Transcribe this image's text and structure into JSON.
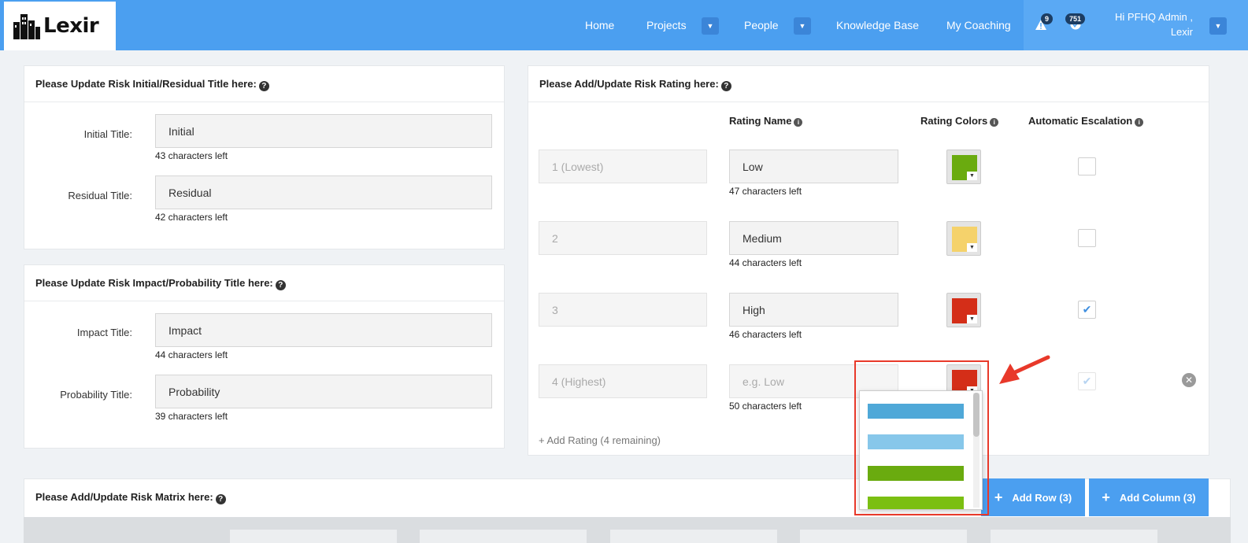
{
  "header": {
    "logo_text": "Lexir",
    "nav": {
      "home": "Home",
      "projects": "Projects",
      "people": "People",
      "knowledge_base": "Knowledge Base",
      "my_coaching": "My Coaching"
    },
    "alerts_badge": "9",
    "tasks_badge": "751",
    "greeting_line1": "Hi PFHQ Admin ,",
    "greeting_line2": "Lexir"
  },
  "initial_residual": {
    "title": "Please Update Risk Initial/Residual Title here:",
    "initial_label": "Initial Title:",
    "initial_value": "Initial",
    "initial_hint": "43 characters left",
    "residual_label": "Residual Title:",
    "residual_value": "Residual",
    "residual_hint": "42 characters left"
  },
  "impact_probability": {
    "title": "Please Update Risk Impact/Probability Title here:",
    "impact_label": "Impact Title:",
    "impact_value": "Impact",
    "impact_hint": "44 characters left",
    "probability_label": "Probability Title:",
    "probability_value": "Probability",
    "probability_hint": "39 characters left"
  },
  "rating": {
    "title": "Please Add/Update Risk Rating here:",
    "col_name": "Rating Name",
    "col_colors": "Rating Colors",
    "col_escalation": "Automatic Escalation",
    "rows": [
      {
        "level": "1 (Lowest)",
        "name": "Low",
        "placeholder": "",
        "hint": "47 characters left",
        "color": "#6aab0f",
        "escalation": false
      },
      {
        "level": "2",
        "name": "Medium",
        "placeholder": "",
        "hint": "44 characters left",
        "color": "#f5d26b",
        "escalation": false
      },
      {
        "level": "3",
        "name": "High",
        "placeholder": "",
        "hint": "46 characters left",
        "color": "#d42e18",
        "escalation": true
      },
      {
        "level": "4 (Highest)",
        "name": "",
        "placeholder": "e.g. Low",
        "hint": "50 characters left",
        "color": "#d42e18",
        "escalation": true
      }
    ],
    "add_rating": "+ Add Rating (4 remaining)"
  },
  "color_dropdown": {
    "options": [
      "#4fa8d8",
      "#87c7ea",
      "#6aab0f",
      "#7bbf12"
    ]
  },
  "matrix": {
    "title": "Please Add/Update Risk Matrix here:",
    "add_row": "Add Row (3)",
    "add_column": "Add Column (3)"
  }
}
